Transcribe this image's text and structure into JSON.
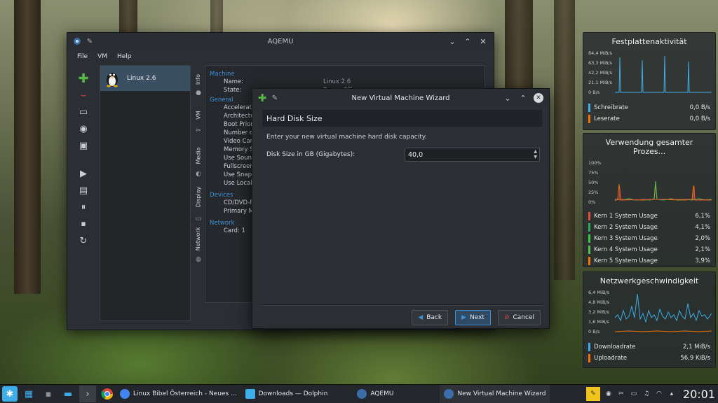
{
  "aqemu": {
    "title": "AQEMU",
    "menu": [
      "File",
      "VM",
      "Help"
    ],
    "vm_name": "Linux 2.6",
    "tabs": [
      "Info",
      "VM",
      "Media",
      "Display",
      "Network"
    ],
    "sections": {
      "machine": {
        "title": "Machine",
        "rows": [
          {
            "label": "Name:",
            "value": "Linux 2.6"
          },
          {
            "label": "State:",
            "value": "Power Off"
          }
        ]
      },
      "general": {
        "title": "General",
        "rows": [
          "Accelerator",
          "Architecture",
          "Boot Priority",
          "Number of C",
          "Video Card",
          "Memory Size",
          "Use Sound",
          "Fullscreen M",
          "Use Snapsh",
          "Use Local Ti"
        ]
      },
      "devices": {
        "title": "Devices",
        "rows": [
          "CD/DVD-ROM",
          "Primary Ma"
        ]
      },
      "network": {
        "title": "Network",
        "rows": [
          "Card: 1"
        ]
      }
    }
  },
  "wizard": {
    "title": "New Virtual Machine Wizard",
    "header": "Hard Disk Size",
    "description": "Enter your new virtual machine hard disk capacity.",
    "field_label": "Disk Size in GB (Gigabytes):",
    "field_value": "40,0",
    "buttons": {
      "back": "Back",
      "next": "Next",
      "cancel": "Cancel"
    }
  },
  "widgets": {
    "disk": {
      "title": "Festplattenaktivität",
      "yticks": [
        "84,4 MiB/s",
        "63,3 MiB/s",
        "42,2 MiB/s",
        "21,1 MiB/s",
        "0 B/s"
      ],
      "legend": [
        {
          "label": "Schreibrate",
          "value": "0,0 B/s",
          "color": "#3daee9"
        },
        {
          "label": "Leserate",
          "value": "0,0 B/s",
          "color": "#f67400"
        }
      ]
    },
    "cpu": {
      "title": "Verwendung gesamter Prozes...",
      "yticks": [
        "100%",
        "75%",
        "50%",
        "25%",
        "0%"
      ],
      "legend": [
        {
          "label": "Kern 1 System Usage",
          "value": "6,1%",
          "color": "#e74c3c"
        },
        {
          "label": "Kern 2 System Usage",
          "value": "4,1%",
          "color": "#27ae60"
        },
        {
          "label": "Kern 3 System Usage",
          "value": "2,0%",
          "color": "#2ecc40"
        },
        {
          "label": "Kern 4 System Usage",
          "value": "2,1%",
          "color": "#55c14a"
        },
        {
          "label": "Kern 5 System Usage",
          "value": "3,9%",
          "color": "#f67400"
        }
      ]
    },
    "net": {
      "title": "Netzwerkgeschwindigkeit",
      "yticks": [
        "6,4 MiB/s",
        "4,8 MiB/s",
        "3,2 MiB/s",
        "1,6 MiB/s",
        "0 B/s"
      ],
      "legend": [
        {
          "label": "Downloadrate",
          "value": "2,1 MiB/s",
          "color": "#3daee9"
        },
        {
          "label": "Uploadrate",
          "value": "56,9 KiB/s",
          "color": "#f67400"
        }
      ]
    }
  },
  "taskbar": {
    "tasks": [
      "Linux Bibel Österreich - Neues ...",
      "Downloads — Dolphin",
      "AQEMU",
      "New Virtual Machine Wizard"
    ],
    "clock": "20:01"
  },
  "colors": {
    "accent": "#3d8fd6",
    "add": "#56b948",
    "close": "#d9463a"
  }
}
